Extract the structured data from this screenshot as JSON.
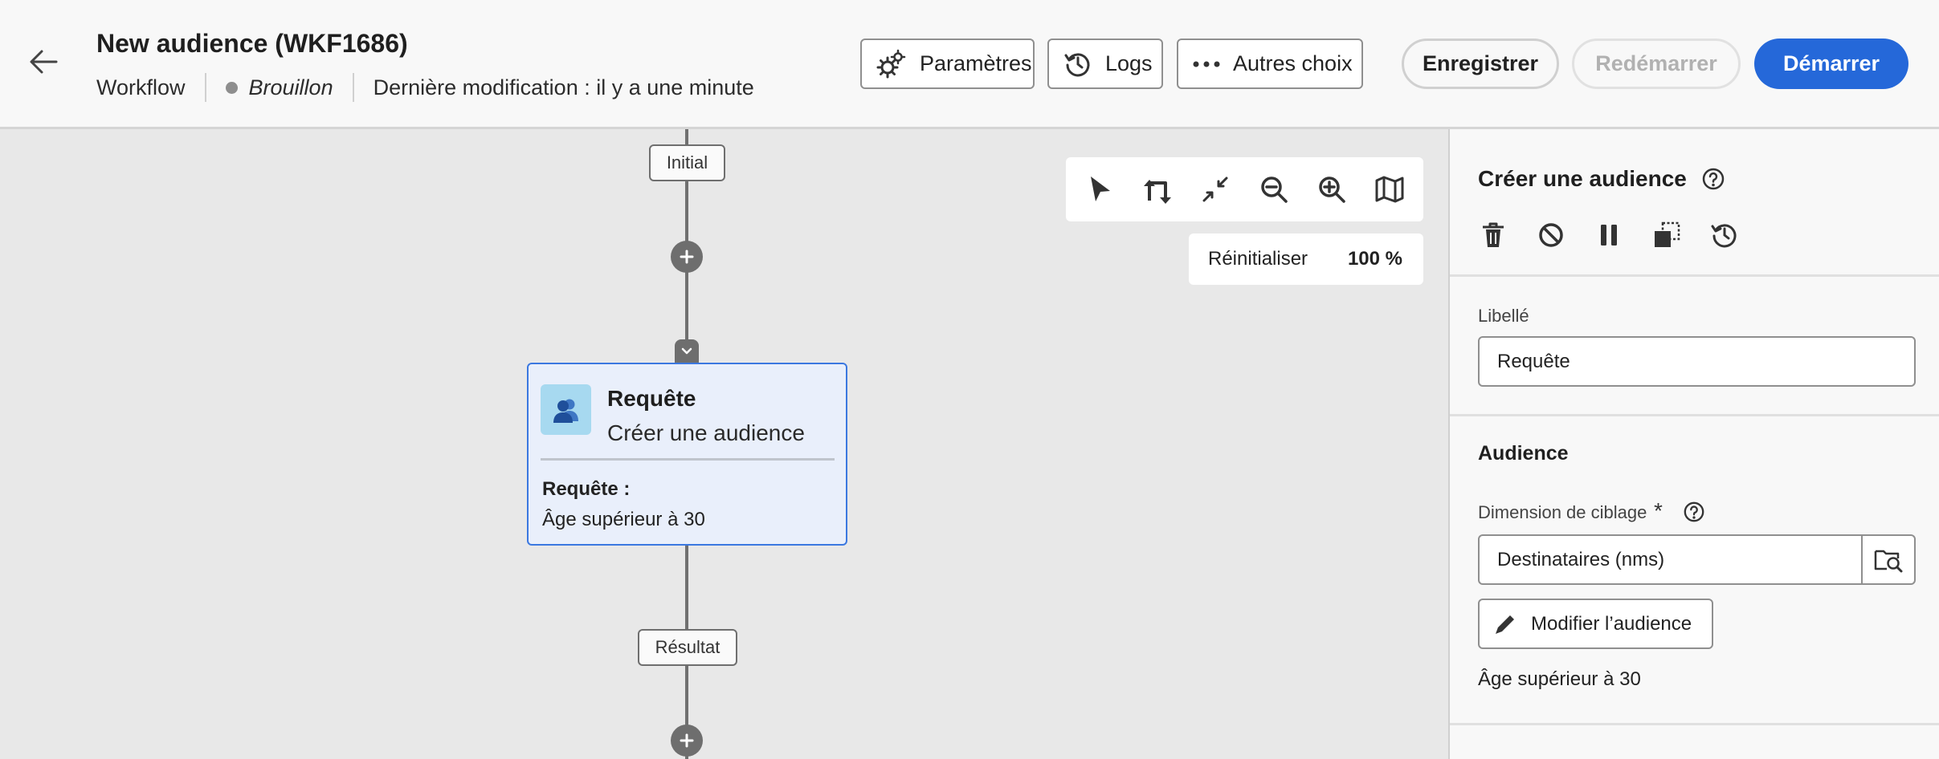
{
  "header": {
    "title": "New audience (WKF1686)",
    "type": "Workflow",
    "status": "Brouillon",
    "last_modified": "Dernière modification : il y a une minute",
    "buttons": {
      "settings": "Paramètres",
      "logs": "Logs",
      "more": "Autres choix",
      "save": "Enregistrer",
      "restart": "Redémarrer",
      "start": "Démarrer"
    },
    "colors": {
      "primary": "#2568d9",
      "status_dot": "#8e8e8e"
    }
  },
  "canvas": {
    "labels": {
      "initial": "Initial",
      "result": "Résultat"
    },
    "activity": {
      "title": "Requête",
      "subtitle": "Créer une audience",
      "query_label": "Requête :",
      "query_value": "Âge supérieur à 30",
      "icon": "audience-icon"
    },
    "toolbar_icons": [
      "select-pointer-icon",
      "auto-layout-icon",
      "collapse-icon",
      "zoom-out-icon",
      "zoom-in-icon",
      "map-icon"
    ],
    "zoom": {
      "reset": "Réinitialiser",
      "level": "100 %"
    }
  },
  "panel": {
    "title": "Créer une audience",
    "action_icons": [
      "delete-icon",
      "disable-icon",
      "pause-icon",
      "copy-icon",
      "history-icon"
    ],
    "label_field": {
      "label": "Libellé",
      "value": "Requête"
    },
    "audience": {
      "section_title": "Audience",
      "targeting_label": "Dimension de ciblage",
      "required_mark": "*",
      "targeting_value": "Destinataires (nms)",
      "edit_button": "Modifier l’audience",
      "condition": "Âge supérieur à 30"
    }
  }
}
